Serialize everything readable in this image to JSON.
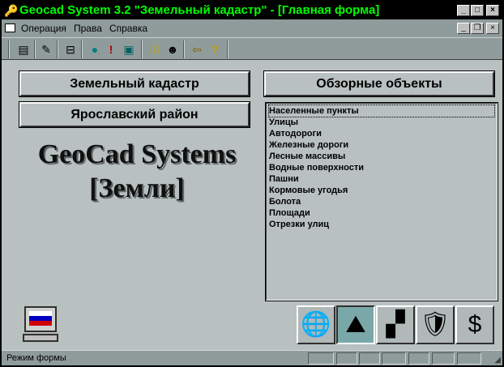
{
  "window": {
    "title": "Geocad System 3.2 \"Земельный кадастр\" - [Главная форма]"
  },
  "menu": [
    "Операция",
    "Права",
    "Справка"
  ],
  "toolbar": [
    "forms-icon",
    "edit-icon",
    "tree-icon",
    "globe-icon",
    "alert-icon",
    "documents-icon",
    "keys-icon",
    "user-icon",
    "exit-icon",
    "help-icon"
  ],
  "main": {
    "button_cadastre": "Земельный кадастр",
    "button_district": "Ярославский район",
    "button_overview": "Обзорные объекты",
    "logo_line1": "GeoCad Systems",
    "logo_line2": "[Земли]",
    "list": [
      "Населенные пункты",
      "Улицы",
      "Автодороги",
      "Железные дороги",
      "Лесные массивы",
      "Водные поверхности",
      "Пашни",
      "Кормовые угодья",
      "Болота",
      "Площади",
      "Отрезки улиц"
    ]
  },
  "status": {
    "text": "Режим формы"
  },
  "colors": {
    "title_bg": "#000000",
    "title_text": "#00ff00"
  }
}
